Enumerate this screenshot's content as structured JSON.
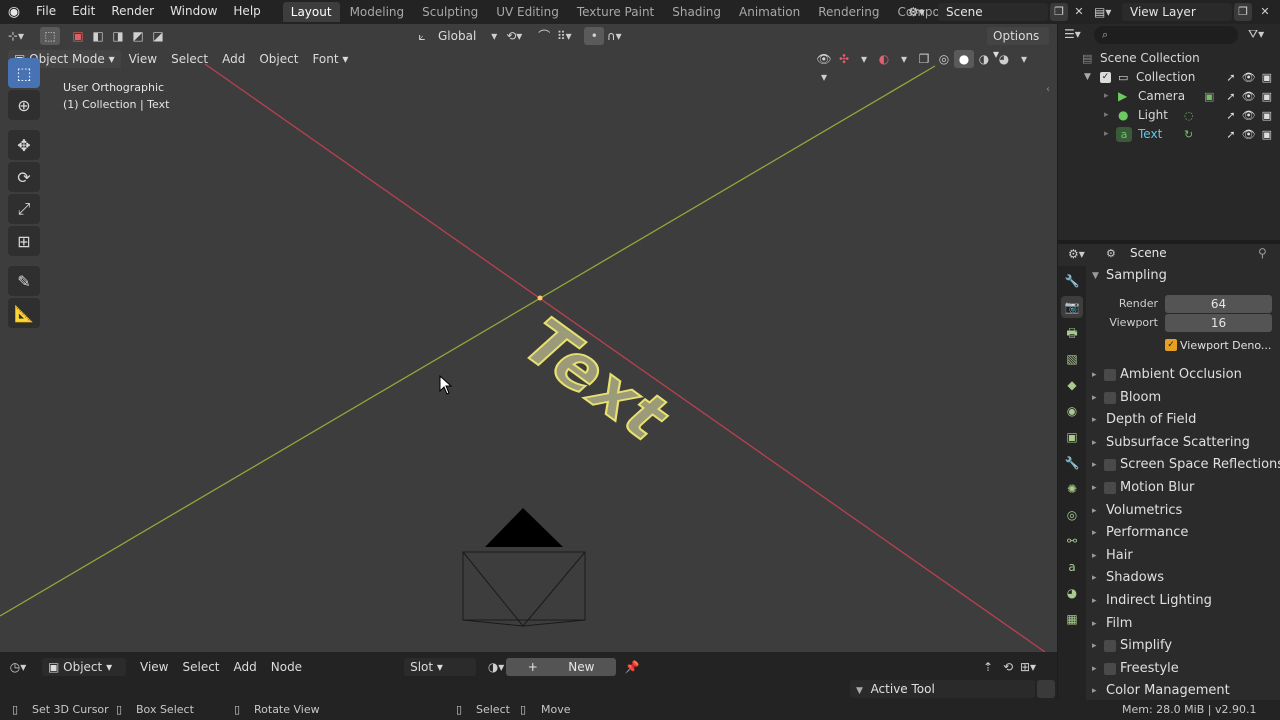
{
  "menu": [
    "File",
    "Edit",
    "Render",
    "Window",
    "Help"
  ],
  "workspaces": [
    "Layout",
    "Modeling",
    "Sculpting",
    "UV Editing",
    "Texture Paint",
    "Shading",
    "Animation",
    "Rendering",
    "Compositing"
  ],
  "active_workspace": "Layout",
  "scene_name": "Scene",
  "view_layer": "View Layer",
  "viewport_header": {
    "orientation": "Global",
    "options": "Options",
    "mode": "Object Mode",
    "menus": [
      "View",
      "Select",
      "Add",
      "Object",
      "Font"
    ]
  },
  "viewport_info": {
    "view_name": "User Orthographic",
    "context": "(1) Collection | Text"
  },
  "text_object_label": "Text",
  "timeline": {
    "mode": "Object",
    "menus": [
      "View",
      "Select",
      "Add",
      "Node"
    ],
    "slot": "Slot",
    "new_label": "New",
    "active_tool": "Active Tool"
  },
  "outliner": {
    "root": "Scene Collection",
    "collection": "Collection",
    "items": [
      "Camera",
      "Light",
      "Text"
    ]
  },
  "properties": {
    "context": "Scene",
    "sampling": {
      "title": "Sampling",
      "render_label": "Render",
      "render_value": "64",
      "viewport_label": "Viewport",
      "viewport_value": "16",
      "denoise_label": "Viewport Deno..."
    },
    "panels": [
      {
        "label": "Ambient Occlusion",
        "checkbox": true
      },
      {
        "label": "Bloom",
        "checkbox": true
      },
      {
        "label": "Depth of Field",
        "checkbox": false
      },
      {
        "label": "Subsurface Scattering",
        "checkbox": false
      },
      {
        "label": "Screen Space Reflections",
        "checkbox": true
      },
      {
        "label": "Motion Blur",
        "checkbox": true
      },
      {
        "label": "Volumetrics",
        "checkbox": false
      },
      {
        "label": "Performance",
        "checkbox": false
      },
      {
        "label": "Hair",
        "checkbox": false
      },
      {
        "label": "Shadows",
        "checkbox": false
      },
      {
        "label": "Indirect Lighting",
        "checkbox": false
      },
      {
        "label": "Film",
        "checkbox": false
      },
      {
        "label": "Simplify",
        "checkbox": true
      },
      {
        "label": "Freestyle",
        "checkbox": true
      },
      {
        "label": "Color Management",
        "checkbox": false
      }
    ]
  },
  "statusbar": {
    "set_cursor": "Set 3D Cursor",
    "box_select": "Box Select",
    "rotate_view": "Rotate View",
    "select": "Select",
    "move": "Move",
    "memory": "Mem: 28.0 MiB | v2.90.1"
  },
  "colors": {
    "accent_blue": "#4772b3",
    "x_axis": "#c04050",
    "y_axis": "#8fa83a",
    "selected_outline": "#e8e070",
    "outliner_active": "#5cc8e8"
  }
}
